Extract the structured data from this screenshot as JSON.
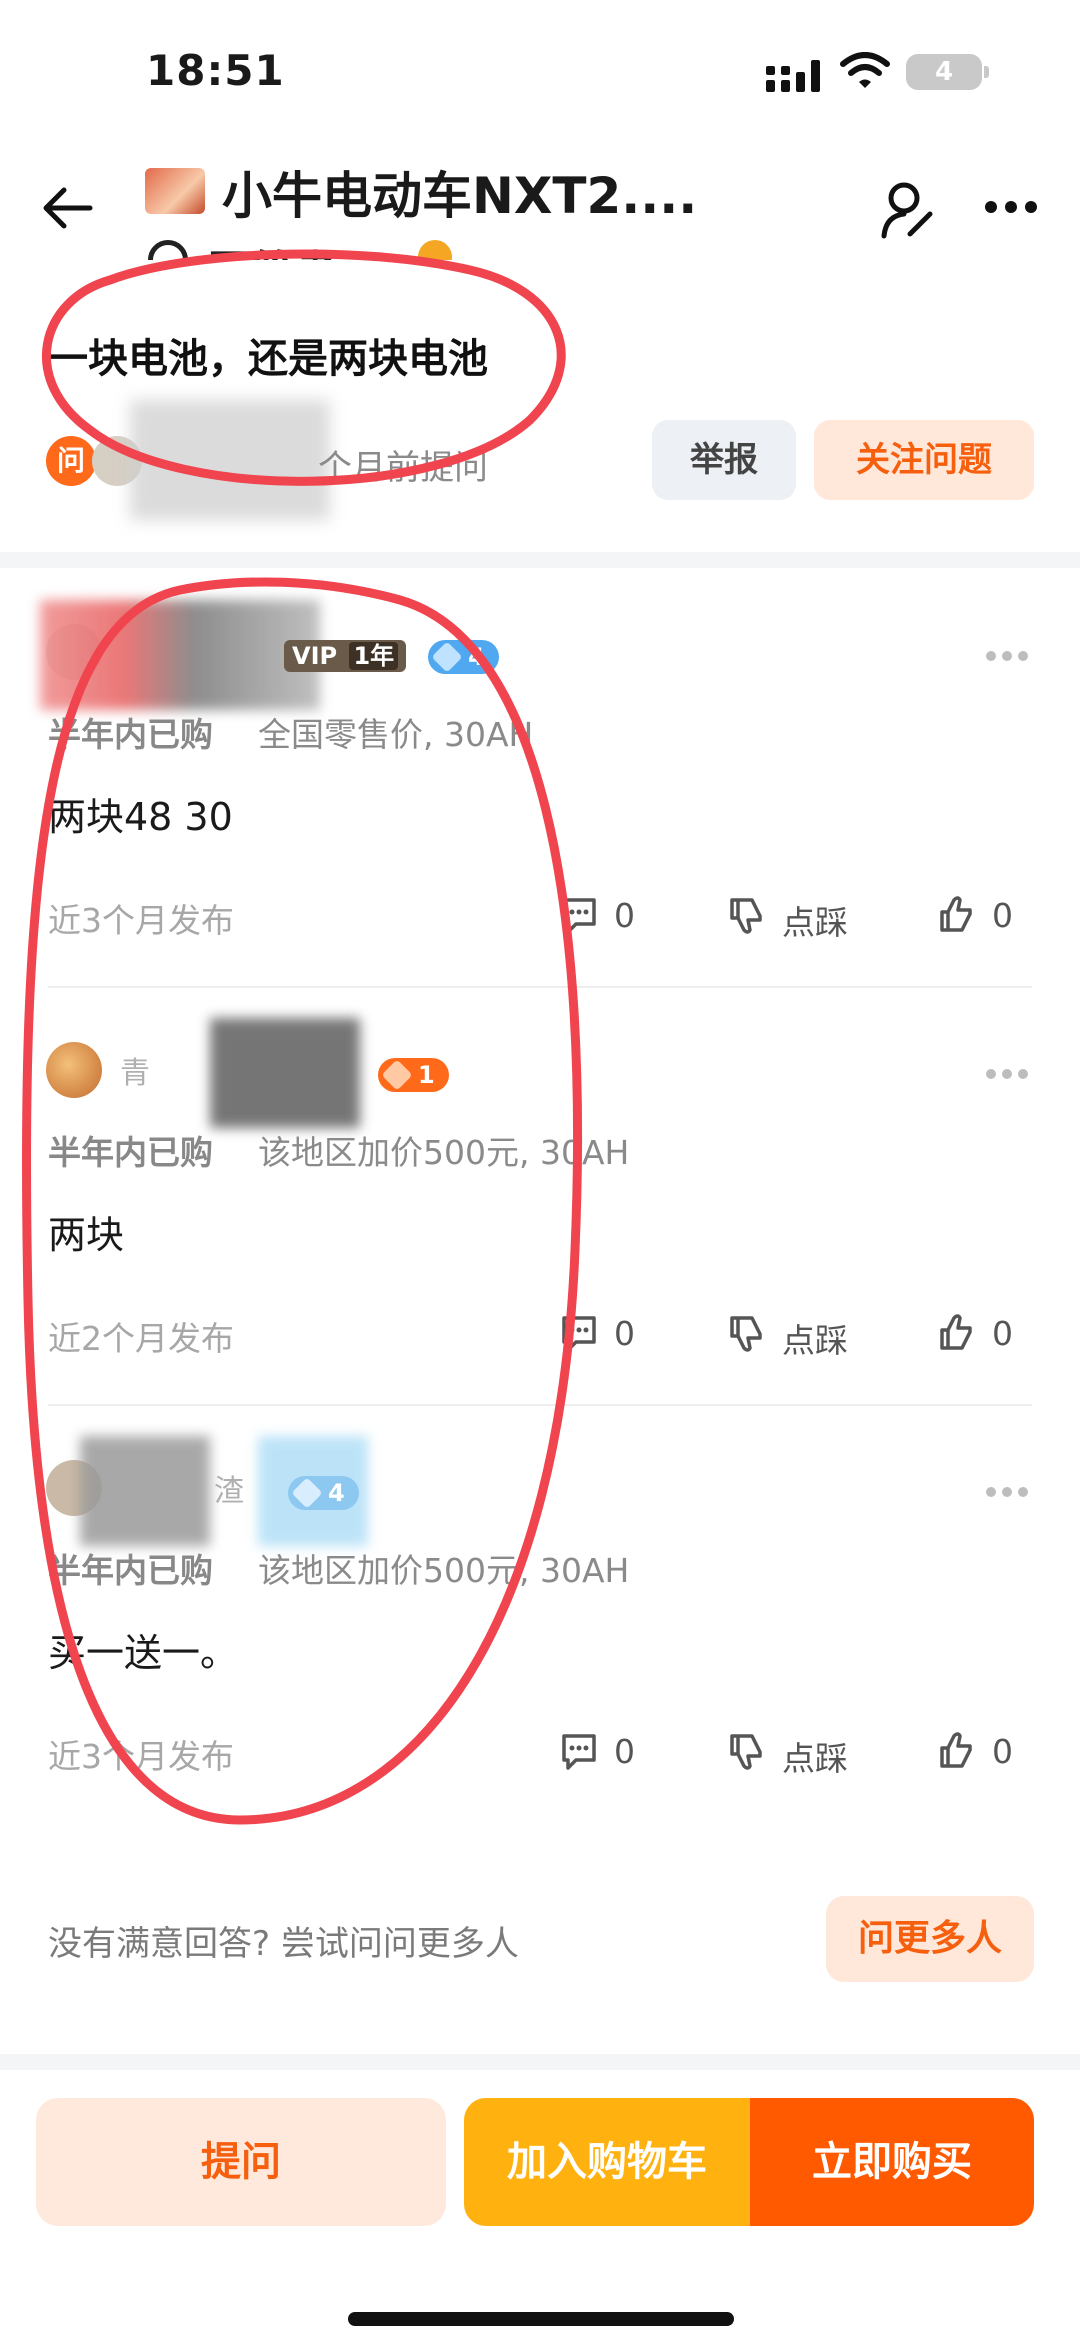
{
  "status_bar": {
    "time": "18:51",
    "battery_level": "4",
    "icons": [
      "signal-icon",
      "wifi-icon",
      "battery-icon"
    ]
  },
  "nav": {
    "product_title": "小牛电动车NXT2....",
    "subtitle": "回答者",
    "icons": [
      "back-icon",
      "user-edit-icon",
      "more-icon"
    ]
  },
  "question": {
    "badge": "问",
    "title": "一块电池，还是两块电池",
    "asked_time": "个月前提问",
    "report_label": "举报",
    "follow_label": "关注问题"
  },
  "answers": [
    {
      "vip": "VIP",
      "vip_years": "1年",
      "level": "4",
      "purchase_tag": "半年内已购",
      "purchase_detail": "全国零售价, 30AH",
      "text": "两块48 30",
      "post_time": "近3个月发布",
      "comment_count": "0",
      "dislike_label": "点踩",
      "like_count": "0"
    },
    {
      "name_fragment": "青",
      "level": "1",
      "purchase_tag": "半年内已购",
      "purchase_detail": "该地区加价500元, 30AH",
      "text": "两块",
      "post_time": "近2个月发布",
      "comment_count": "0",
      "dislike_label": "点踩",
      "like_count": "0"
    },
    {
      "name_fragment": "渣",
      "level": "4",
      "purchase_tag": "半年内已购",
      "purchase_detail": "该地区加价500元, 30AH",
      "text": "买一送一。",
      "post_time": "近3个月发布",
      "comment_count": "0",
      "dislike_label": "点踩",
      "like_count": "0"
    }
  ],
  "more": {
    "prompt": "没有满意回答? 尝试问问更多人",
    "button_label": "问更多人"
  },
  "bottom_bar": {
    "ask_label": "提问",
    "cart_label": "加入购物车",
    "buy_label": "立即购买"
  },
  "colors": {
    "accent_orange": "#ff5a00",
    "cart_yellow": "#ffb20f",
    "annotation_red": "#f0454f"
  }
}
